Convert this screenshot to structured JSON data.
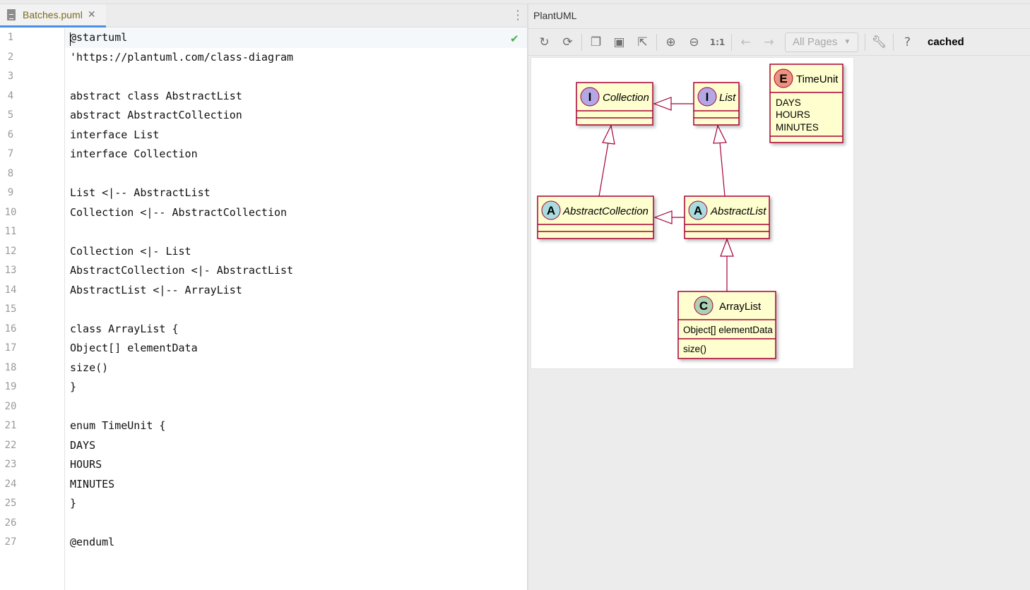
{
  "editor": {
    "tab": {
      "label": "Batches.puml",
      "icon": "puml-file-icon",
      "close_icon": "close-icon"
    },
    "status_icon": "check-icon",
    "lines": [
      "@startuml",
      "'https://plantuml.com/class-diagram",
      "",
      "abstract class AbstractList",
      "abstract AbstractCollection",
      "interface List",
      "interface Collection",
      "",
      "List <|-- AbstractList",
      "Collection <|-- AbstractCollection",
      "",
      "Collection <|- List",
      "AbstractCollection <|- AbstractList",
      "AbstractList <|-- ArrayList",
      "",
      "class ArrayList {",
      "Object[] elementData",
      "size()",
      "}",
      "",
      "enum TimeUnit {",
      "DAYS",
      "HOURS",
      "MINUTES",
      "}",
      "",
      "@enduml"
    ]
  },
  "preview": {
    "title": "PlantUML",
    "toolbar": {
      "icons": [
        "refresh-icon",
        "sync-icon",
        "copy-icon",
        "save-icon",
        "export-icon",
        "zoom-in-icon",
        "zoom-out-icon",
        "actual-size-icon",
        "back-icon",
        "forward-icon"
      ],
      "actual_size_label": "1:1",
      "pages_select": "All Pages",
      "settings_icon": "wrench-icon",
      "help_label": "?",
      "status": "cached"
    },
    "diagram": {
      "colors": {
        "border": "#a80036",
        "fill": "#fefece",
        "interface": "#b4a7e5",
        "abstract": "#a9dcdf",
        "class": "#add1b2",
        "enum": "#eb937f"
      },
      "classes": {
        "collection": {
          "stereotype": "I",
          "name": "Collection"
        },
        "list": {
          "stereotype": "I",
          "name": "List"
        },
        "timeunit": {
          "stereotype": "E",
          "name": "TimeUnit",
          "values": [
            "DAYS",
            "HOURS",
            "MINUTES"
          ]
        },
        "abstract_collection": {
          "stereotype": "A",
          "name": "AbstractCollection"
        },
        "abstract_list": {
          "stereotype": "A",
          "name": "AbstractList"
        },
        "arraylist": {
          "stereotype": "C",
          "name": "ArrayList",
          "fields": [
            "Object[] elementData"
          ],
          "methods": [
            "size()"
          ]
        }
      }
    }
  }
}
